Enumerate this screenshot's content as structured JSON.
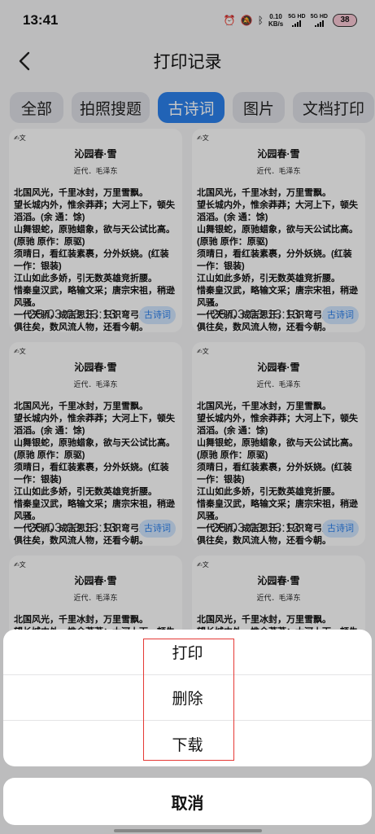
{
  "status": {
    "time": "13:41",
    "net_speed_value": "0.10",
    "net_speed_unit": "KB/s",
    "signal1": "5G HD",
    "signal2": "5G HD",
    "battery": "38"
  },
  "header": {
    "title": "打印记录"
  },
  "tabs": [
    {
      "label": "全部",
      "active": false
    },
    {
      "label": "拍照搜题",
      "active": false
    },
    {
      "label": "古诗词",
      "active": true
    },
    {
      "label": "图片",
      "active": false
    },
    {
      "label": "文档打印",
      "active": false
    }
  ],
  "cards": [
    {
      "badge": "✍文",
      "title": "沁园春·雪",
      "author": "近代．毛泽东",
      "body": "北国风光，千里冰封，万里雪飘。\n望长城内外，惟余莽莽；大河上下，顿失滔滔。(余 通：馀)\n山舞银蛇，原驰蜡象，欲与天公试比高。(原驰 原作：原驱)\n须晴日，看红装素裹，分外妖娆。(红装 一作：银装)\n江山如此多娇，引无数英雄竞折腰。\n惜秦皇汉武，略输文采；唐宗宋祖，稍逊风骚。\n一代天骄，成吉思汗，只识弯弓射大雕。\n俱往矣，数风流人物，还看今朝。",
      "date": "25-03-03 13:13",
      "tag": "古诗词"
    },
    {
      "badge": "✍文",
      "title": "沁园春·雪",
      "author": "近代．毛泽东",
      "body": "北国风光，千里冰封，万里雪飘。\n望长城内外，惟余莽莽；大河上下，顿失滔滔。(余 通：馀)\n山舞银蛇，原驰蜡象，欲与天公试比高。(原驰 原作：原驱)\n须晴日，看红装素裹，分外妖娆。(红装 一作：银装)\n江山如此多娇，引无数英雄竞折腰。\n惜秦皇汉武，略输文采；唐宗宋祖，稍逊风骚。\n一代天骄，成吉思汗，只识弯弓射大雕。\n俱往矣，数风流人物，还看今朝。",
      "date": "25-03-03 13:13",
      "tag": "古诗词"
    },
    {
      "badge": "✍文",
      "title": "沁园春·雪",
      "author": "近代．毛泽东",
      "body": "北国风光，千里冰封，万里雪飘。\n望长城内外，惟余莽莽；大河上下，顿失滔滔。(余 通：馀)\n山舞银蛇，原驰蜡象，欲与天公试比高。(原驰 原作：原驱)\n须晴日，看红装素裹，分外妖娆。(红装 一作：银装)\n江山如此多娇，引无数英雄竞折腰。\n惜秦皇汉武，略输文采；唐宗宋祖，稍逊风骚。\n一代天骄，成吉思汗，只识弯弓射大雕。\n俱往矣，数风流人物，还看今朝。",
      "date": "25-03-03 13:13",
      "tag": "古诗词"
    },
    {
      "badge": "✍文",
      "title": "沁园春·雪",
      "author": "近代．毛泽东",
      "body": "北国风光，千里冰封，万里雪飘。\n望长城内外，惟余莽莽；大河上下，顿失滔滔。(余 通：馀)\n山舞银蛇，原驰蜡象，欲与天公试比高。(原驰 原作：原驱)\n须晴日，看红装素裹，分外妖娆。(红装 一作：银装)\n江山如此多娇，引无数英雄竞折腰。\n惜秦皇汉武，略输文采；唐宗宋祖，稍逊风骚。\n一代天骄，成吉思汗，只识弯弓射大雕。\n俱往矣，数风流人物，还看今朝。",
      "date": "25-03-03 13:12",
      "tag": "古诗词"
    },
    {
      "badge": "✍文",
      "title": "沁园春·雪",
      "author": "近代．毛泽东",
      "body": "北国风光，千里冰封，万里雪飘。\n望长城内外，惟余莽莽；大河上下，顿失滔滔。(余 通：馀)",
      "date": "",
      "tag": ""
    },
    {
      "badge": "✍文",
      "title": "沁园春·雪",
      "author": "近代．毛泽东",
      "body": "北国风光，千里冰封，万里雪飘。\n望长城内外，惟余莽莽；大河上下，顿失滔滔。(余 通：馀)",
      "date": "",
      "tag": ""
    }
  ],
  "action_sheet": {
    "print": "打印",
    "delete": "删除",
    "download": "下载",
    "cancel": "取消"
  },
  "colors": {
    "accent": "#2b7fea",
    "highlight": "#e53935"
  }
}
